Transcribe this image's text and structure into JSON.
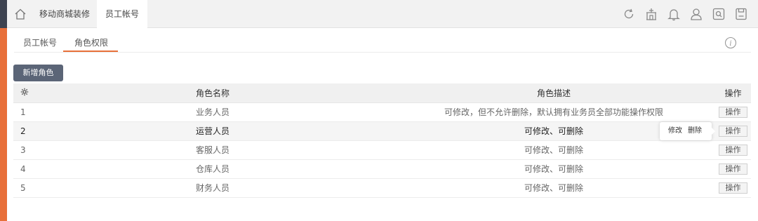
{
  "topbar": {
    "home_icon": "home-icon",
    "tabs": [
      {
        "label": "移动商城装修",
        "active": false
      },
      {
        "label": "员工帐号",
        "active": true
      }
    ],
    "icons": [
      "refresh-icon",
      "store-icon",
      "bell-icon",
      "user-icon",
      "search-icon",
      "save-icon"
    ]
  },
  "subtabs": [
    {
      "label": "员工帐号",
      "active": false
    },
    {
      "label": "角色权限",
      "active": true
    }
  ],
  "info_icon": "info-icon",
  "add_button": "新增角色",
  "table": {
    "headers": {
      "settings_icon": "gear-icon",
      "name": "角色名称",
      "desc": "角色描述",
      "op": "操作"
    },
    "rows": [
      {
        "idx": "1",
        "name": "业务人员",
        "desc": "可修改，但不允许删除，默认拥有业务员全部功能操作权限",
        "op": "操作"
      },
      {
        "idx": "2",
        "name": "运营人员",
        "desc": "可修改、可删除",
        "op": "操作"
      },
      {
        "idx": "3",
        "name": "客服人员",
        "desc": "可修改、可删除",
        "op": "操作"
      },
      {
        "idx": "4",
        "name": "仓库人员",
        "desc": "可修改、可删除",
        "op": "操作"
      },
      {
        "idx": "5",
        "name": "财务人员",
        "desc": "可修改、可删除",
        "op": "操作"
      }
    ]
  },
  "popover": {
    "edit": "修改",
    "delete": "删除"
  },
  "colors": {
    "accent": "#e8703a",
    "sidebar_dark": "#3d4350",
    "button": "#5b6577"
  }
}
